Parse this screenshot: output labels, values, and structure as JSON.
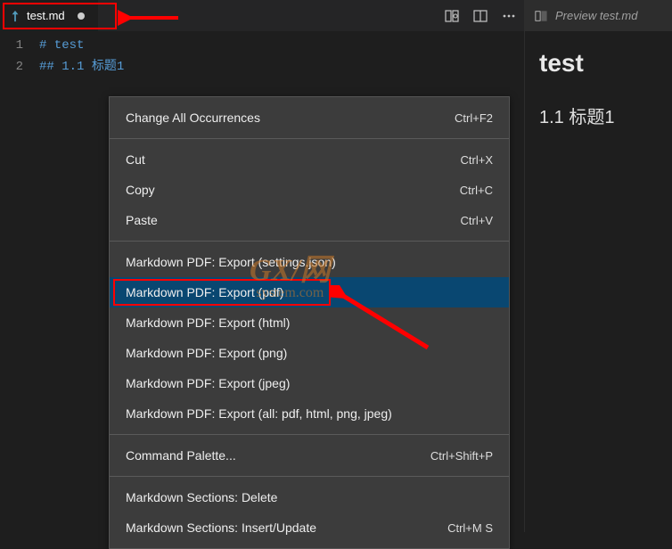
{
  "tab": {
    "label": "test.md",
    "icon": "markdown-icon"
  },
  "toolbar": {
    "preview_icon": "open-preview-icon",
    "split_icon": "split-editor-icon",
    "more_icon": "more-actions-icon"
  },
  "editor": {
    "lines": [
      {
        "num": "1",
        "hash": "#",
        "text": " test"
      },
      {
        "num": "2",
        "hash": "##",
        "num2": " 1.1 ",
        "title": "标题1"
      }
    ]
  },
  "context_menu": {
    "groups": [
      [
        {
          "label": "Change All Occurrences",
          "shortcut": "Ctrl+F2"
        }
      ],
      [
        {
          "label": "Cut",
          "shortcut": "Ctrl+X"
        },
        {
          "label": "Copy",
          "shortcut": "Ctrl+C"
        },
        {
          "label": "Paste",
          "shortcut": "Ctrl+V"
        }
      ],
      [
        {
          "label": "Markdown PDF: Export (settings.json)",
          "shortcut": ""
        },
        {
          "label": "Markdown PDF: Export (pdf)",
          "shortcut": "",
          "highlighted": true,
          "boxed": true
        },
        {
          "label": "Markdown PDF: Export (html)",
          "shortcut": ""
        },
        {
          "label": "Markdown PDF: Export (png)",
          "shortcut": ""
        },
        {
          "label": "Markdown PDF: Export (jpeg)",
          "shortcut": ""
        },
        {
          "label": "Markdown PDF: Export (all: pdf, html, png, jpeg)",
          "shortcut": ""
        }
      ],
      [
        {
          "label": "Command Palette...",
          "shortcut": "Ctrl+Shift+P"
        }
      ],
      [
        {
          "label": "Markdown Sections: Delete",
          "shortcut": ""
        },
        {
          "label": "Markdown Sections: Insert/Update",
          "shortcut": "Ctrl+M S"
        }
      ]
    ]
  },
  "preview": {
    "tab_label": "Preview test.md",
    "h1": "test",
    "h2": "1.1 标题1"
  },
  "watermark": {
    "top": "GX/网",
    "bottom": "system.com"
  }
}
